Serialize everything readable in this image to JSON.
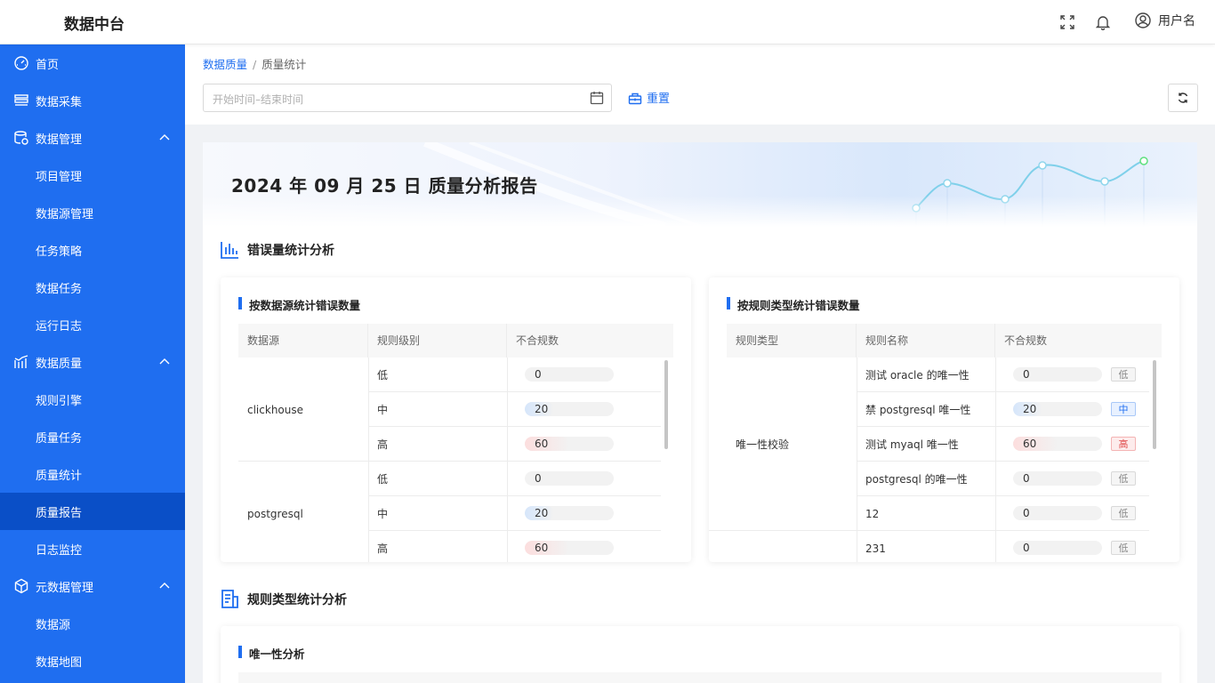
{
  "header": {
    "app_title": "数据中台",
    "user_name": "用户名",
    "icons": [
      "fullscreen-icon",
      "bell-icon",
      "user-icon"
    ]
  },
  "sidebar": {
    "items": [
      {
        "label": "首页",
        "icon": "dashboard-icon"
      },
      {
        "label": "数据采集",
        "icon": "collect-icon"
      },
      {
        "label": "数据管理",
        "icon": "manage-icon",
        "expanded": true
      },
      {
        "label": "项目管理"
      },
      {
        "label": "数据源管理"
      },
      {
        "label": "任务策略"
      },
      {
        "label": "数据任务"
      },
      {
        "label": "运行日志"
      },
      {
        "label": "数据质量",
        "icon": "quality-icon",
        "expanded": true
      },
      {
        "label": "规则引擎"
      },
      {
        "label": "质量任务"
      },
      {
        "label": "质量统计"
      },
      {
        "label": "质量报告",
        "active": true
      },
      {
        "label": "日志监控"
      },
      {
        "label": "元数据管理",
        "icon": "metadata-icon",
        "expanded": true
      },
      {
        "label": "数据源"
      },
      {
        "label": "数据地图"
      }
    ],
    "accent": "#1f6ef0",
    "active_color": "#0a4fc7"
  },
  "breadcrumb": {
    "parent": "数据质量",
    "separator": "/",
    "current": "质量统计"
  },
  "toolbar": {
    "date_placeholder": "开始时间–结束时间",
    "reset_label": "重置"
  },
  "report": {
    "title": "2024 年 09 月 25 日 质量分析报告"
  },
  "sections": {
    "error_stats": "错误量统计分析",
    "rule_type_stats": "规则类型统计分析"
  },
  "by_source": {
    "title": "按数据源统计错误数量",
    "headers": [
      "数据源",
      "规则级别",
      "不合规数"
    ],
    "groups": [
      {
        "source": "clickhouse",
        "rows": [
          {
            "level": "低",
            "count": "0",
            "ratio": 0.0
          },
          {
            "level": "中",
            "count": "20",
            "ratio": 0.5
          },
          {
            "level": "高",
            "count": "60",
            "ratio": 0.75
          }
        ]
      },
      {
        "source": "postgresql",
        "rows": [
          {
            "level": "低",
            "count": "0",
            "ratio": 0.0
          },
          {
            "level": "中",
            "count": "20",
            "ratio": 0.5
          },
          {
            "level": "高",
            "count": "60",
            "ratio": 0.75
          }
        ]
      }
    ]
  },
  "by_rule_type": {
    "title": "按规则类型统计错误数量",
    "headers": [
      "规则类型",
      "规则名称",
      "不合规数"
    ],
    "rule_type": "唯一性校验",
    "rows": [
      {
        "name": "测试 oracle 的唯一性",
        "count": "0",
        "level": "低",
        "cls": "low",
        "ratio": 0.0
      },
      {
        "name": "禁 postgresql 唯一性",
        "count": "20",
        "level": "中",
        "cls": "mid",
        "ratio": 0.5
      },
      {
        "name": "测试 myaql 唯一性",
        "count": "60",
        "level": "高",
        "cls": "high",
        "ratio": 0.75
      },
      {
        "name": "postgresql 的唯一性",
        "count": "0",
        "level": "低",
        "cls": "low",
        "ratio": 0.0
      },
      {
        "name": "12",
        "count": "0",
        "level": "低",
        "cls": "low",
        "ratio": 0.0
      },
      {
        "name": "231",
        "count": "0",
        "level": "低",
        "cls": "low",
        "ratio": 0.0
      }
    ]
  },
  "uniqueness": {
    "title": "唯一性分析"
  },
  "colors": {
    "mid_fill": "#d6e6fb",
    "high_fill": "#fcdede",
    "brand": "#1f6ef0"
  }
}
